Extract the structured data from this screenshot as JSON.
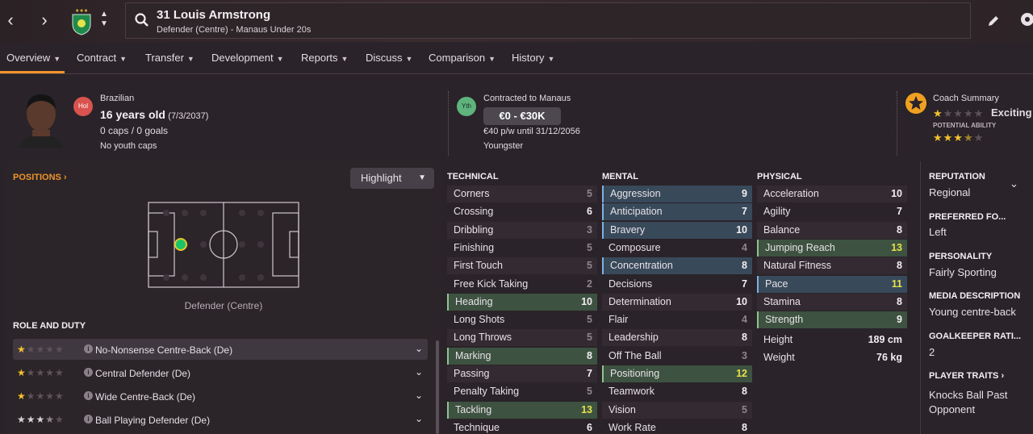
{
  "header": {
    "player_name": "31 Louis Armstrong",
    "player_subtitle": "Defender (Centre) - Manaus Under 20s"
  },
  "tabs": [
    {
      "label": "Overview"
    },
    {
      "label": "Contract"
    },
    {
      "label": "Transfer"
    },
    {
      "label": "Development"
    },
    {
      "label": "Reports"
    },
    {
      "label": "Discuss"
    },
    {
      "label": "Comparison"
    },
    {
      "label": "History"
    }
  ],
  "summary": {
    "position_badge": "Hol",
    "nationality": "Brazilian",
    "age": "16 years old",
    "dob": "(7/3/2037)",
    "caps": "0 caps / 0 goals",
    "youth_caps": "No youth caps",
    "contract_badge": "Yth",
    "contracted_to": "Contracted to Manaus",
    "value": "€0 - €30K",
    "wage": "€40 p/w until 31/12/2056",
    "status": "Youngster",
    "coach_summary_label": "Coach Summary",
    "coach_summary_value": "Exciting",
    "potential_label": "POTENTIAL ABILITY",
    "current_stars": 1,
    "potential_stars": 3.5
  },
  "positions": {
    "title": "POSITIONS",
    "highlight_label": "Highlight",
    "caption": "Defender (Centre)"
  },
  "roles": {
    "title": "ROLE AND DUTY",
    "items": [
      {
        "label": "No-Nonsense Centre-Back (De)",
        "stars": 1
      },
      {
        "label": "Central Defender (De)",
        "stars": 1
      },
      {
        "label": "Wide Centre-Back (De)",
        "stars": 1
      },
      {
        "label": "Ball Playing Defender (De)",
        "stars": 3.5
      }
    ]
  },
  "technical": {
    "title": "TECHNICAL",
    "items": [
      {
        "name": "Corners",
        "value": "5",
        "tone": "dim",
        "hl": ""
      },
      {
        "name": "Crossing",
        "value": "6",
        "tone": "norm",
        "hl": ""
      },
      {
        "name": "Dribbling",
        "value": "3",
        "tone": "dim",
        "hl": ""
      },
      {
        "name": "Finishing",
        "value": "5",
        "tone": "dim",
        "hl": ""
      },
      {
        "name": "First Touch",
        "value": "5",
        "tone": "dim",
        "hl": ""
      },
      {
        "name": "Free Kick Taking",
        "value": "2",
        "tone": "dim",
        "hl": ""
      },
      {
        "name": "Heading",
        "value": "10",
        "tone": "norm",
        "hl": "green"
      },
      {
        "name": "Long Shots",
        "value": "5",
        "tone": "dim",
        "hl": ""
      },
      {
        "name": "Long Throws",
        "value": "5",
        "tone": "dim",
        "hl": ""
      },
      {
        "name": "Marking",
        "value": "8",
        "tone": "norm",
        "hl": "green"
      },
      {
        "name": "Passing",
        "value": "7",
        "tone": "norm",
        "hl": ""
      },
      {
        "name": "Penalty Taking",
        "value": "5",
        "tone": "dim",
        "hl": ""
      },
      {
        "name": "Tackling",
        "value": "13",
        "tone": "yellow",
        "hl": "green"
      },
      {
        "name": "Technique",
        "value": "6",
        "tone": "norm",
        "hl": ""
      }
    ]
  },
  "mental": {
    "title": "MENTAL",
    "items": [
      {
        "name": "Aggression",
        "value": "9",
        "tone": "norm",
        "hl": "blue"
      },
      {
        "name": "Anticipation",
        "value": "7",
        "tone": "norm",
        "hl": "blue"
      },
      {
        "name": "Bravery",
        "value": "10",
        "tone": "norm",
        "hl": "blue"
      },
      {
        "name": "Composure",
        "value": "4",
        "tone": "dim",
        "hl": ""
      },
      {
        "name": "Concentration",
        "value": "8",
        "tone": "norm",
        "hl": "blue"
      },
      {
        "name": "Decisions",
        "value": "7",
        "tone": "norm",
        "hl": ""
      },
      {
        "name": "Determination",
        "value": "10",
        "tone": "norm",
        "hl": ""
      },
      {
        "name": "Flair",
        "value": "4",
        "tone": "dim",
        "hl": ""
      },
      {
        "name": "Leadership",
        "value": "8",
        "tone": "norm",
        "hl": ""
      },
      {
        "name": "Off The Ball",
        "value": "3",
        "tone": "dim",
        "hl": ""
      },
      {
        "name": "Positioning",
        "value": "12",
        "tone": "yellow",
        "hl": "green"
      },
      {
        "name": "Teamwork",
        "value": "8",
        "tone": "norm",
        "hl": ""
      },
      {
        "name": "Vision",
        "value": "5",
        "tone": "dim",
        "hl": ""
      },
      {
        "name": "Work Rate",
        "value": "8",
        "tone": "norm",
        "hl": ""
      }
    ]
  },
  "physical": {
    "title": "PHYSICAL",
    "items": [
      {
        "name": "Acceleration",
        "value": "10",
        "tone": "norm",
        "hl": ""
      },
      {
        "name": "Agility",
        "value": "7",
        "tone": "norm",
        "hl": ""
      },
      {
        "name": "Balance",
        "value": "8",
        "tone": "norm",
        "hl": ""
      },
      {
        "name": "Jumping Reach",
        "value": "13",
        "tone": "yellow",
        "hl": "green"
      },
      {
        "name": "Natural Fitness",
        "value": "8",
        "tone": "norm",
        "hl": ""
      },
      {
        "name": "Pace",
        "value": "11",
        "tone": "yellow",
        "hl": "blue"
      },
      {
        "name": "Stamina",
        "value": "8",
        "tone": "norm",
        "hl": ""
      },
      {
        "name": "Strength",
        "value": "9",
        "tone": "norm",
        "hl": "green"
      }
    ],
    "height_label": "Height",
    "height_value": "189 cm",
    "weight_label": "Weight",
    "weight_value": "76 kg"
  },
  "info": {
    "reputation_title": "REPUTATION",
    "reputation_value": "Regional",
    "foot_title": "PREFERRED FO...",
    "foot_value": "Left",
    "personality_title": "PERSONALITY",
    "personality_value": "Fairly Sporting",
    "media_title": "MEDIA DESCRIPTION",
    "media_value": "Young centre-back",
    "gk_title": "GOALKEEPER RATI...",
    "gk_value": "2",
    "traits_title": "PLAYER TRAITS",
    "traits_line1": "Knocks Ball Past",
    "traits_line2": "Opponent"
  },
  "colors": {
    "accent": "#f0932b",
    "highlight_green": "#3d5240",
    "highlight_blue": "#38495a",
    "star": "#f2c12e"
  }
}
